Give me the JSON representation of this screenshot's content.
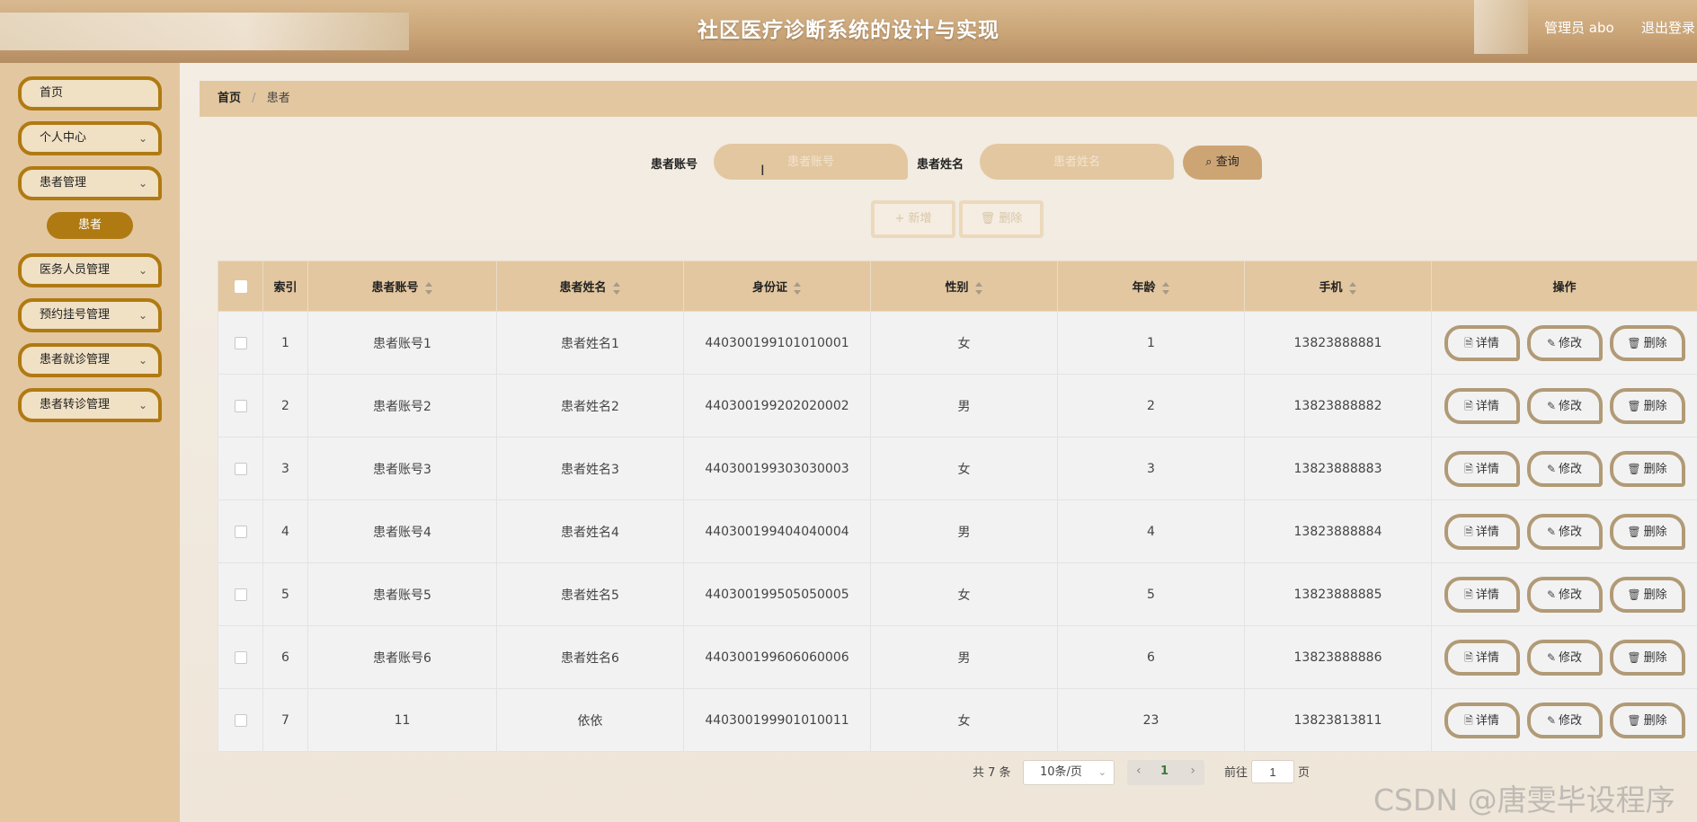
{
  "header": {
    "title": "社区医疗诊断系统的设计与实现",
    "user": "管理员 abo",
    "logout": "退出登录"
  },
  "sidebar": {
    "items": [
      {
        "label": "首页"
      },
      {
        "label": "个人中心"
      },
      {
        "label": "患者管理"
      },
      {
        "label": "医务人员管理"
      },
      {
        "label": "预约挂号管理"
      },
      {
        "label": "患者就诊管理"
      },
      {
        "label": "患者转诊管理"
      }
    ],
    "active_sub": "患者",
    "chevron": "⌄"
  },
  "breadcrumb": {
    "home": "首页",
    "sep": "/",
    "current": "患者"
  },
  "search": {
    "account_label": "患者账号",
    "account_placeholder": "患者账号",
    "name_label": "患者姓名",
    "name_placeholder": "患者姓名",
    "button": "查询"
  },
  "toolbar": {
    "add": "新增",
    "delete": "删除"
  },
  "table": {
    "headers": {
      "index": "索引",
      "account": "患者账号",
      "name": "患者姓名",
      "idcard": "身份证",
      "gender": "性别",
      "age": "年龄",
      "phone": "手机",
      "ops": "操作"
    },
    "rows": [
      {
        "index": "1",
        "account": "患者账号1",
        "name": "患者姓名1",
        "idcard": "440300199101010001",
        "gender": "女",
        "age": "1",
        "phone": "13823888881"
      },
      {
        "index": "2",
        "account": "患者账号2",
        "name": "患者姓名2",
        "idcard": "440300199202020002",
        "gender": "男",
        "age": "2",
        "phone": "13823888882"
      },
      {
        "index": "3",
        "account": "患者账号3",
        "name": "患者姓名3",
        "idcard": "440300199303030003",
        "gender": "女",
        "age": "3",
        "phone": "13823888883"
      },
      {
        "index": "4",
        "account": "患者账号4",
        "name": "患者姓名4",
        "idcard": "440300199404040004",
        "gender": "男",
        "age": "4",
        "phone": "13823888884"
      },
      {
        "index": "5",
        "account": "患者账号5",
        "name": "患者姓名5",
        "idcard": "440300199505050005",
        "gender": "女",
        "age": "5",
        "phone": "13823888885"
      },
      {
        "index": "6",
        "account": "患者账号6",
        "name": "患者姓名6",
        "idcard": "440300199606060006",
        "gender": "男",
        "age": "6",
        "phone": "13823888886"
      },
      {
        "index": "7",
        "account": "11",
        "name": "依依",
        "idcard": "440300199901010011",
        "gender": "女",
        "age": "23",
        "phone": "13823813811"
      }
    ],
    "ops": {
      "detail": "详情",
      "edit": "修改",
      "delete": "删除"
    }
  },
  "pagination": {
    "total": "共 7 条",
    "page_size": "10条/页",
    "current_page": "1",
    "goto_label": "前往",
    "goto_value": "1",
    "page_label": "页"
  },
  "watermark": "CSDN @唐雯毕设程序"
}
